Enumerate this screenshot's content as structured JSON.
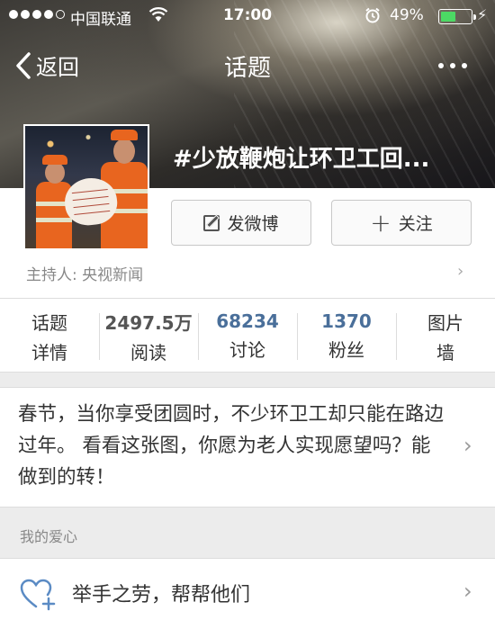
{
  "status_bar": {
    "carrier": "中国联通",
    "time": "17:00",
    "battery": "49%"
  },
  "nav": {
    "back_label": "返回",
    "title": "话题"
  },
  "topic": {
    "title": "#少放鞭炮让环卫工回..."
  },
  "actions": {
    "post_label": "发微博",
    "follow_label": "关注"
  },
  "host": {
    "label": "主持人: 央视新闻"
  },
  "stats": [
    {
      "top": "话题",
      "bottom": "详情"
    },
    {
      "top": "2497.5万",
      "bottom": "阅读"
    },
    {
      "top": "68234",
      "bottom": "讨论"
    },
    {
      "top": "1370",
      "bottom": "粉丝"
    },
    {
      "top": "图片",
      "bottom": "墙"
    }
  ],
  "description": {
    "text": "春节，当你享受团圆时，不少环卫工却只能在路边过年。 看看这张图，你愿为老人实现愿望吗？能做到的转！"
  },
  "section": {
    "label": "我的爱心"
  },
  "love": {
    "label": "举手之劳，帮帮他们"
  },
  "colors": {
    "link_blue": "#4a6f9a",
    "battery_green": "#4cd964",
    "worker_orange": "#e8651f"
  }
}
